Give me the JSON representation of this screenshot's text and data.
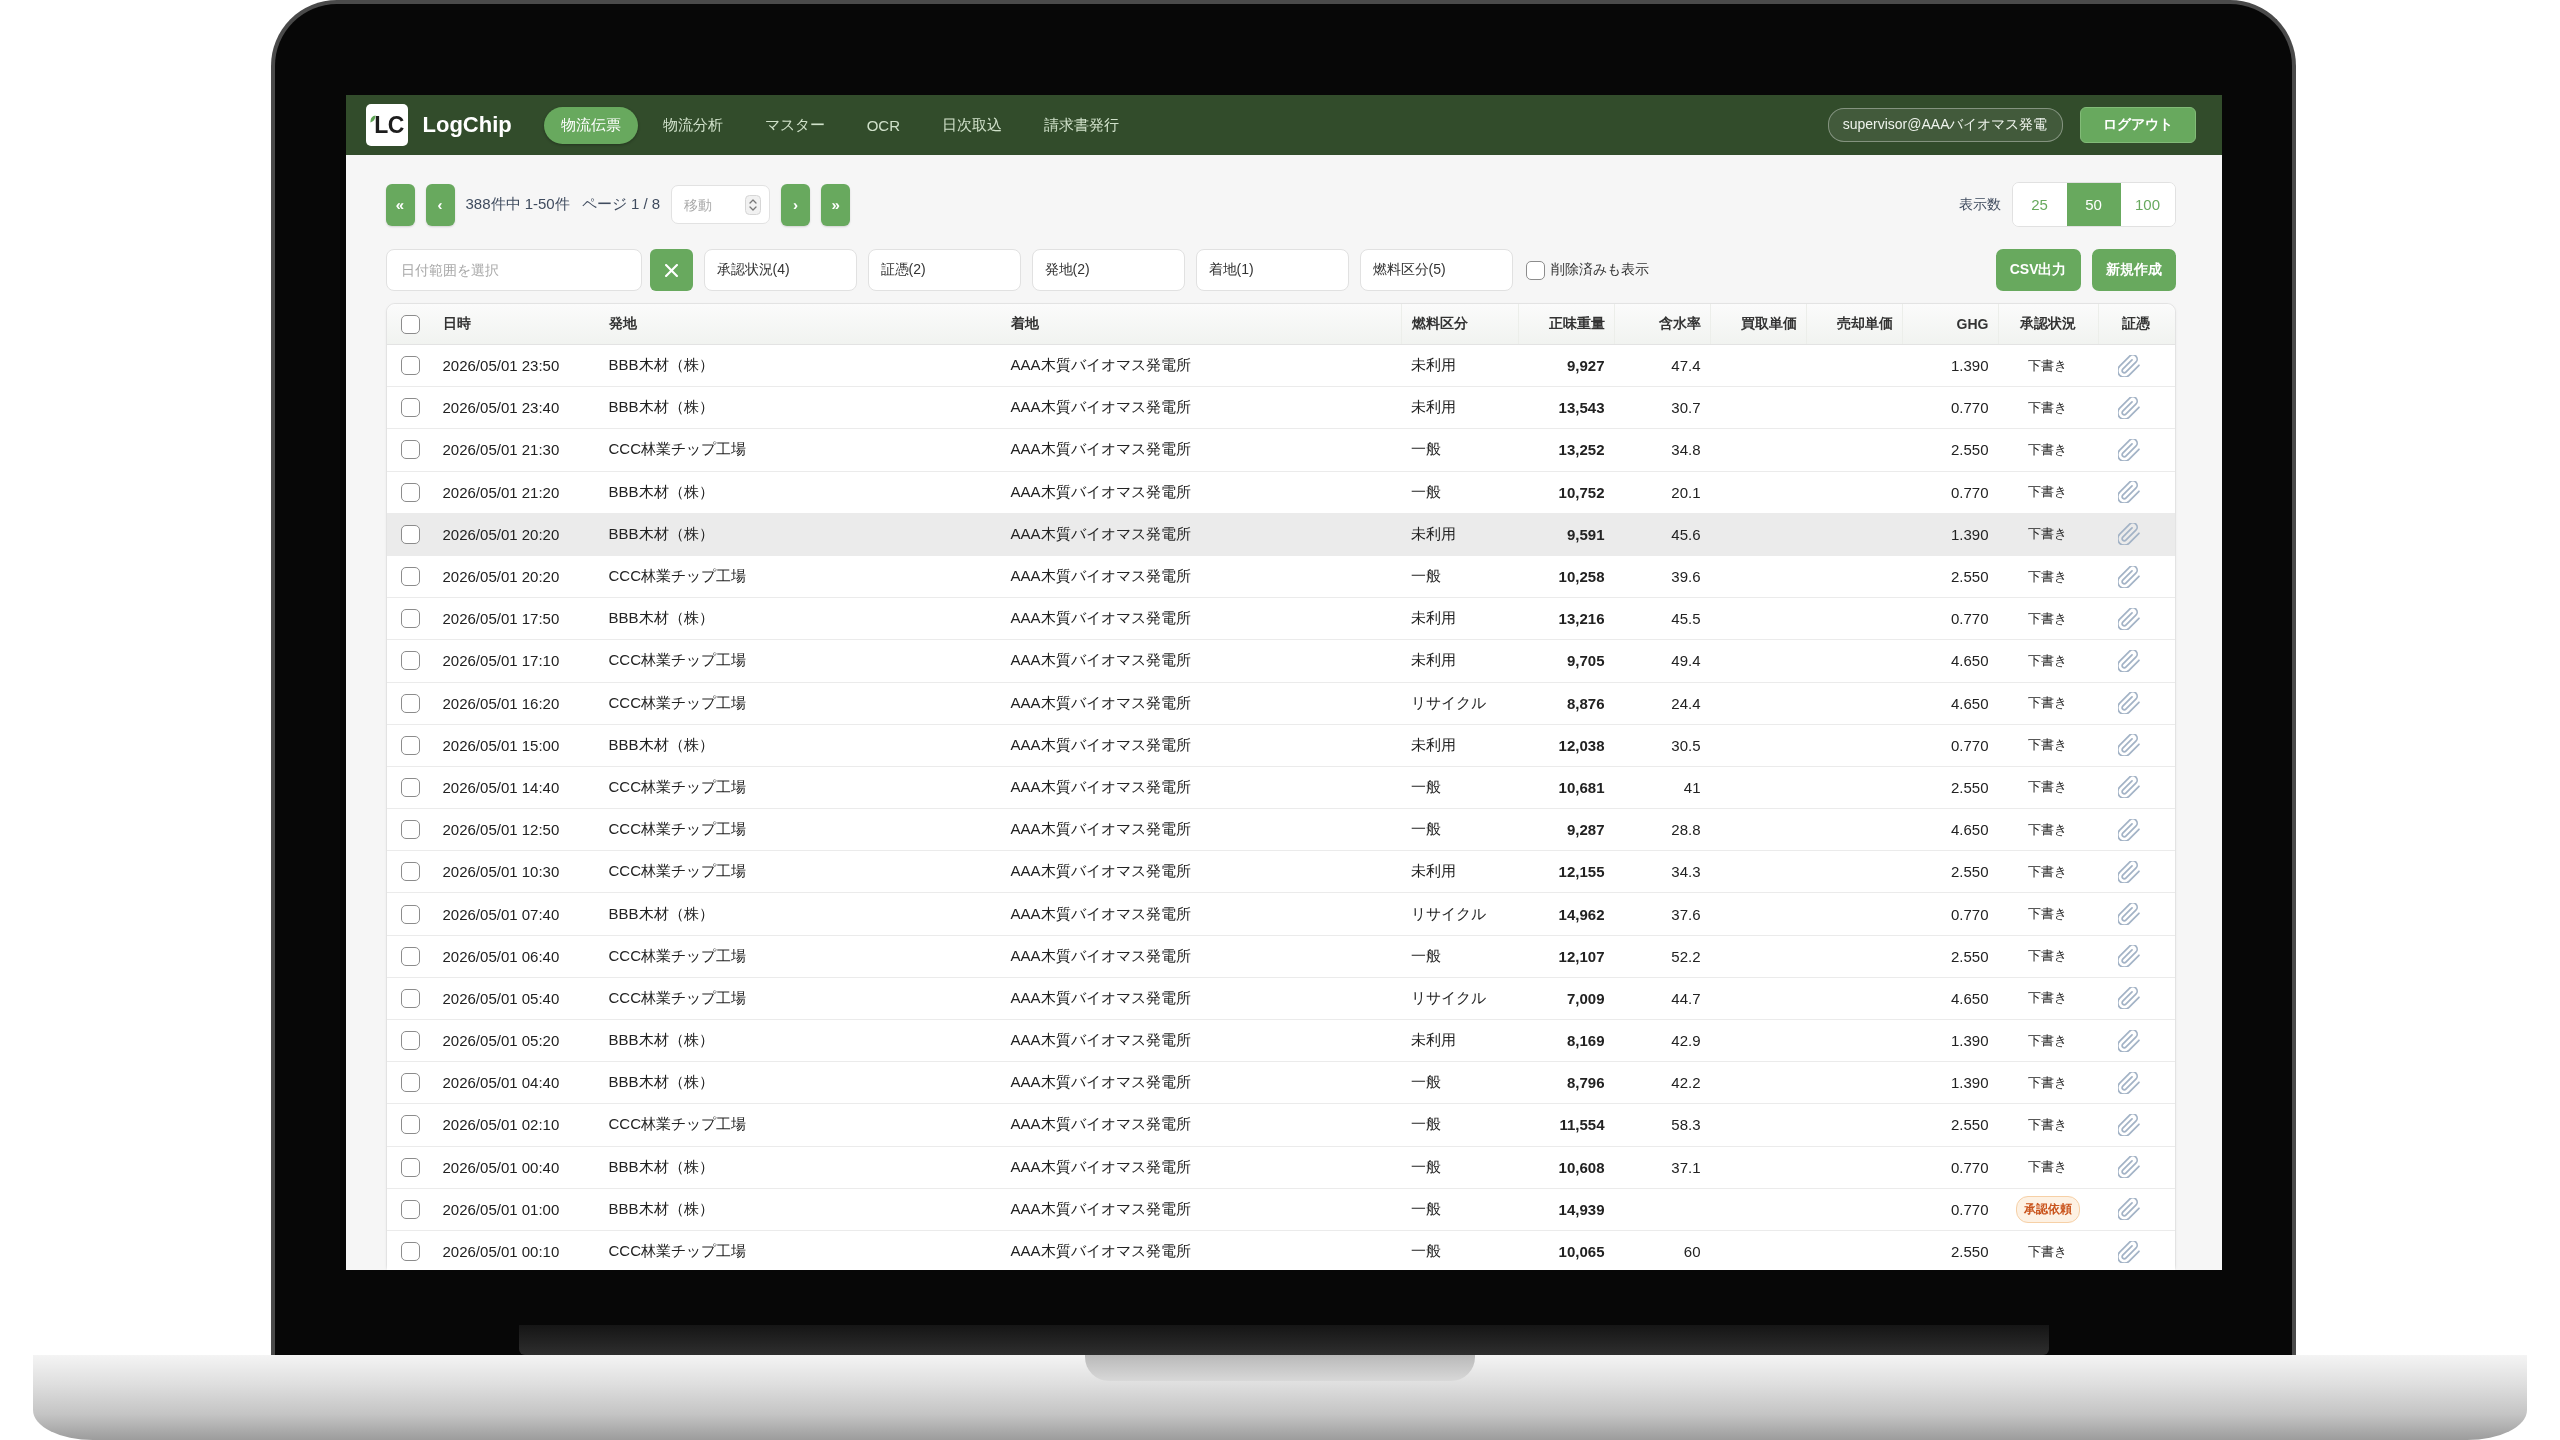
{
  "header": {
    "logo": {
      "mark": "LC",
      "name": "LogChip"
    },
    "nav": [
      {
        "label": "物流伝票",
        "selected": true
      },
      {
        "label": "物流分析",
        "selected": false
      },
      {
        "label": "マスター",
        "selected": false
      },
      {
        "label": "OCR",
        "selected": false
      },
      {
        "label": "日次取込",
        "selected": false
      },
      {
        "label": "請求書発行",
        "selected": false
      }
    ],
    "user": "supervisor@AAAバイオマス発電",
    "logout": "ログアウト"
  },
  "pager": {
    "first": "«",
    "prev": "‹",
    "summary": "388件中 1-50件",
    "page": "ページ 1 / 8",
    "jump_placeholder": "移動",
    "next": "›",
    "last": "»",
    "page_size_label": "表示数",
    "page_sizes": [
      {
        "label": "25",
        "selected": false
      },
      {
        "label": "50",
        "selected": true
      },
      {
        "label": "100",
        "selected": false
      }
    ]
  },
  "filters": {
    "date_placeholder": "日付範囲を選択",
    "dropdowns": [
      "承認状況(4)",
      "証憑(2)",
      "発地(2)",
      "着地(1)",
      "燃料区分(5)"
    ],
    "show_deleted": {
      "label": "削除済みも表示",
      "checked": false
    },
    "buttons": [
      "CSV出力",
      "新規作成"
    ]
  },
  "table": {
    "select_all_checked": false,
    "columns": [
      "日時",
      "発地",
      "着地",
      "燃料区分",
      "正味重量",
      "含水率",
      "買取単価",
      "売却単価",
      "GHG",
      "承認状況",
      "証憑"
    ],
    "rows": [
      {
        "checked": false,
        "hovered": false,
        "date": "2026/05/01 23:50",
        "origin": "BBB木材（株）",
        "destination": "AAA木質バイオマス発電所",
        "fuel_type": "未利用",
        "net_weight": "9,927",
        "moisture": "47.4",
        "ghg": "1.390",
        "status": {
          "label": "下書き",
          "kind": "draft"
        },
        "attachment": true
      },
      {
        "checked": false,
        "hovered": false,
        "date": "2026/05/01 23:40",
        "origin": "BBB木材（株）",
        "destination": "AAA木質バイオマス発電所",
        "fuel_type": "未利用",
        "net_weight": "13,543",
        "moisture": "30.7",
        "ghg": "0.770",
        "status": {
          "label": "下書き",
          "kind": "draft"
        },
        "attachment": true
      },
      {
        "checked": false,
        "hovered": false,
        "date": "2026/05/01 21:30",
        "origin": "CCC林業チップ工場",
        "destination": "AAA木質バイオマス発電所",
        "fuel_type": "一般",
        "net_weight": "13,252",
        "moisture": "34.8",
        "ghg": "2.550",
        "status": {
          "label": "下書き",
          "kind": "draft"
        },
        "attachment": true
      },
      {
        "checked": false,
        "hovered": false,
        "date": "2026/05/01 21:20",
        "origin": "BBB木材（株）",
        "destination": "AAA木質バイオマス発電所",
        "fuel_type": "一般",
        "net_weight": "10,752",
        "moisture": "20.1",
        "ghg": "0.770",
        "status": {
          "label": "下書き",
          "kind": "draft"
        },
        "attachment": true
      },
      {
        "checked": false,
        "hovered": true,
        "date": "2026/05/01 20:20",
        "origin": "BBB木材（株）",
        "destination": "AAA木質バイオマス発電所",
        "fuel_type": "未利用",
        "net_weight": "9,591",
        "moisture": "45.6",
        "ghg": "1.390",
        "status": {
          "label": "下書き",
          "kind": "draft"
        },
        "attachment": true
      },
      {
        "checked": false,
        "hovered": false,
        "date": "2026/05/01 20:20",
        "origin": "CCC林業チップ工場",
        "destination": "AAA木質バイオマス発電所",
        "fuel_type": "一般",
        "net_weight": "10,258",
        "moisture": "39.6",
        "ghg": "2.550",
        "status": {
          "label": "下書き",
          "kind": "draft"
        },
        "attachment": true
      },
      {
        "checked": false,
        "hovered": false,
        "date": "2026/05/01 17:50",
        "origin": "BBB木材（株）",
        "destination": "AAA木質バイオマス発電所",
        "fuel_type": "未利用",
        "net_weight": "13,216",
        "moisture": "45.5",
        "ghg": "0.770",
        "status": {
          "label": "下書き",
          "kind": "draft"
        },
        "attachment": true
      },
      {
        "checked": false,
        "hovered": false,
        "date": "2026/05/01 17:10",
        "origin": "CCC林業チップ工場",
        "destination": "AAA木質バイオマス発電所",
        "fuel_type": "未利用",
        "net_weight": "9,705",
        "moisture": "49.4",
        "ghg": "4.650",
        "status": {
          "label": "下書き",
          "kind": "draft"
        },
        "attachment": true
      },
      {
        "checked": false,
        "hovered": false,
        "date": "2026/05/01 16:20",
        "origin": "CCC林業チップ工場",
        "destination": "AAA木質バイオマス発電所",
        "fuel_type": "リサイクル",
        "net_weight": "8,876",
        "moisture": "24.4",
        "ghg": "4.650",
        "status": {
          "label": "下書き",
          "kind": "draft"
        },
        "attachment": true
      },
      {
        "checked": false,
        "hovered": false,
        "date": "2026/05/01 15:00",
        "origin": "BBB木材（株）",
        "destination": "AAA木質バイオマス発電所",
        "fuel_type": "未利用",
        "net_weight": "12,038",
        "moisture": "30.5",
        "ghg": "0.770",
        "status": {
          "label": "下書き",
          "kind": "draft"
        },
        "attachment": true
      },
      {
        "checked": false,
        "hovered": false,
        "date": "2026/05/01 14:40",
        "origin": "CCC林業チップ工場",
        "destination": "AAA木質バイオマス発電所",
        "fuel_type": "一般",
        "net_weight": "10,681",
        "moisture": "41",
        "ghg": "2.550",
        "status": {
          "label": "下書き",
          "kind": "draft"
        },
        "attachment": true
      },
      {
        "checked": false,
        "hovered": false,
        "date": "2026/05/01 12:50",
        "origin": "CCC林業チップ工場",
        "destination": "AAA木質バイオマス発電所",
        "fuel_type": "一般",
        "net_weight": "9,287",
        "moisture": "28.8",
        "ghg": "4.650",
        "status": {
          "label": "下書き",
          "kind": "draft"
        },
        "attachment": true
      },
      {
        "checked": false,
        "hovered": false,
        "date": "2026/05/01 10:30",
        "origin": "CCC林業チップ工場",
        "destination": "AAA木質バイオマス発電所",
        "fuel_type": "未利用",
        "net_weight": "12,155",
        "moisture": "34.3",
        "ghg": "2.550",
        "status": {
          "label": "下書き",
          "kind": "draft"
        },
        "attachment": true
      },
      {
        "checked": false,
        "hovered": false,
        "date": "2026/05/01 07:40",
        "origin": "BBB木材（株）",
        "destination": "AAA木質バイオマス発電所",
        "fuel_type": "リサイクル",
        "net_weight": "14,962",
        "moisture": "37.6",
        "ghg": "0.770",
        "status": {
          "label": "下書き",
          "kind": "draft"
        },
        "attachment": true
      },
      {
        "checked": false,
        "hovered": false,
        "date": "2026/05/01 06:40",
        "origin": "CCC林業チップ工場",
        "destination": "AAA木質バイオマス発電所",
        "fuel_type": "一般",
        "net_weight": "12,107",
        "moisture": "52.2",
        "ghg": "2.550",
        "status": {
          "label": "下書き",
          "kind": "draft"
        },
        "attachment": true
      },
      {
        "checked": false,
        "hovered": false,
        "date": "2026/05/01 05:40",
        "origin": "CCC林業チップ工場",
        "destination": "AAA木質バイオマス発電所",
        "fuel_type": "リサイクル",
        "net_weight": "7,009",
        "moisture": "44.7",
        "ghg": "4.650",
        "status": {
          "label": "下書き",
          "kind": "draft"
        },
        "attachment": true
      },
      {
        "checked": false,
        "hovered": false,
        "date": "2026/05/01 05:20",
        "origin": "BBB木材（株）",
        "destination": "AAA木質バイオマス発電所",
        "fuel_type": "未利用",
        "net_weight": "8,169",
        "moisture": "42.9",
        "ghg": "1.390",
        "status": {
          "label": "下書き",
          "kind": "draft"
        },
        "attachment": true
      },
      {
        "checked": false,
        "hovered": false,
        "date": "2026/05/01 04:40",
        "origin": "BBB木材（株）",
        "destination": "AAA木質バイオマス発電所",
        "fuel_type": "一般",
        "net_weight": "8,796",
        "moisture": "42.2",
        "ghg": "1.390",
        "status": {
          "label": "下書き",
          "kind": "draft"
        },
        "attachment": true
      },
      {
        "checked": false,
        "hovered": false,
        "date": "2026/05/01 02:10",
        "origin": "CCC林業チップ工場",
        "destination": "AAA木質バイオマス発電所",
        "fuel_type": "一般",
        "net_weight": "11,554",
        "moisture": "58.3",
        "ghg": "2.550",
        "status": {
          "label": "下書き",
          "kind": "draft"
        },
        "attachment": true
      },
      {
        "checked": false,
        "hovered": false,
        "date": "2026/05/01 00:40",
        "origin": "BBB木材（株）",
        "destination": "AAA木質バイオマス発電所",
        "fuel_type": "一般",
        "net_weight": "10,608",
        "moisture": "37.1",
        "ghg": "0.770",
        "status": {
          "label": "下書き",
          "kind": "draft"
        },
        "attachment": true
      },
      {
        "checked": false,
        "hovered": false,
        "date": "2026/05/01 01:00",
        "origin": "BBB木材（株）",
        "destination": "AAA木質バイオマス発電所",
        "fuel_type": "一般",
        "net_weight": "14,939",
        "ghg": "0.770",
        "status": {
          "label": "承認依頼",
          "kind": "requested"
        },
        "attachment": true
      },
      {
        "checked": false,
        "hovered": false,
        "date": "2026/05/01 00:10",
        "origin": "CCC林業チップ工場",
        "destination": "AAA木質バイオマス発電所",
        "fuel_type": "一般",
        "net_weight": "10,065",
        "moisture": "60",
        "ghg": "2.550",
        "status": {
          "label": "下書き",
          "kind": "draft"
        },
        "attachment": true
      }
    ]
  }
}
